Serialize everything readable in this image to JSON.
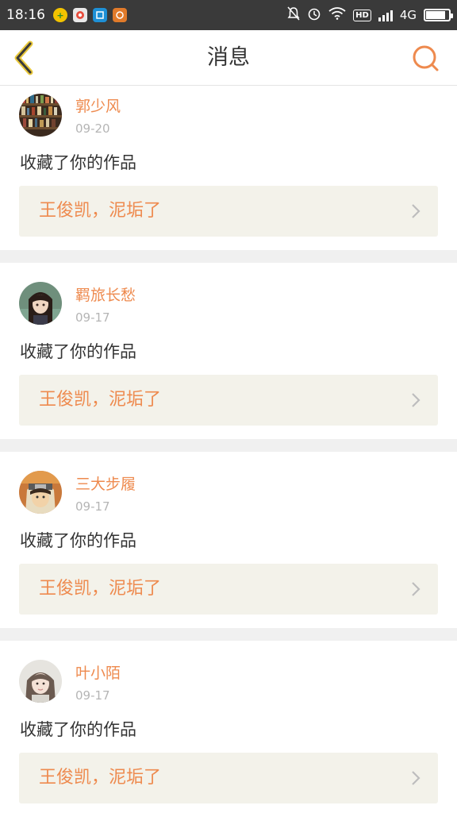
{
  "status_bar": {
    "time": "18:16",
    "hd_label": "HD",
    "network": "4G",
    "battery_percent": 85,
    "left_icons": [
      "plus-circle-icon",
      "photo-app-icon",
      "scan-app-icon",
      "camera-app-icon"
    ],
    "right_icons": [
      "mute-bell-icon",
      "alarm-icon",
      "wifi-icon",
      "hd-icon",
      "signal-icon",
      "battery-icon"
    ]
  },
  "header": {
    "title": "消息",
    "back_icon": "chevron-left-icon",
    "search_icon": "search-icon",
    "accent_color": "#ee8a4e",
    "back_color": "#e9c83b"
  },
  "messages": [
    {
      "user": "郭少风",
      "date": "09-20",
      "action": "收藏了你的作品",
      "work_title": "王俊凯，泥垢了",
      "avatar": "bookshelf-avatar"
    },
    {
      "user": "羁旅长愁",
      "date": "09-17",
      "action": "收藏了你的作品",
      "work_title": "王俊凯，泥垢了",
      "avatar": "anime-girl-avatar"
    },
    {
      "user": "三大步履",
      "date": "09-17",
      "action": "收藏了你的作品",
      "work_title": "王俊凯，泥垢了",
      "avatar": "ninja-avatar"
    },
    {
      "user": "叶小陌",
      "date": "09-17",
      "action": "收藏了你的作品",
      "work_title": "王俊凯，泥垢了",
      "avatar": "girl-portrait-avatar"
    }
  ]
}
